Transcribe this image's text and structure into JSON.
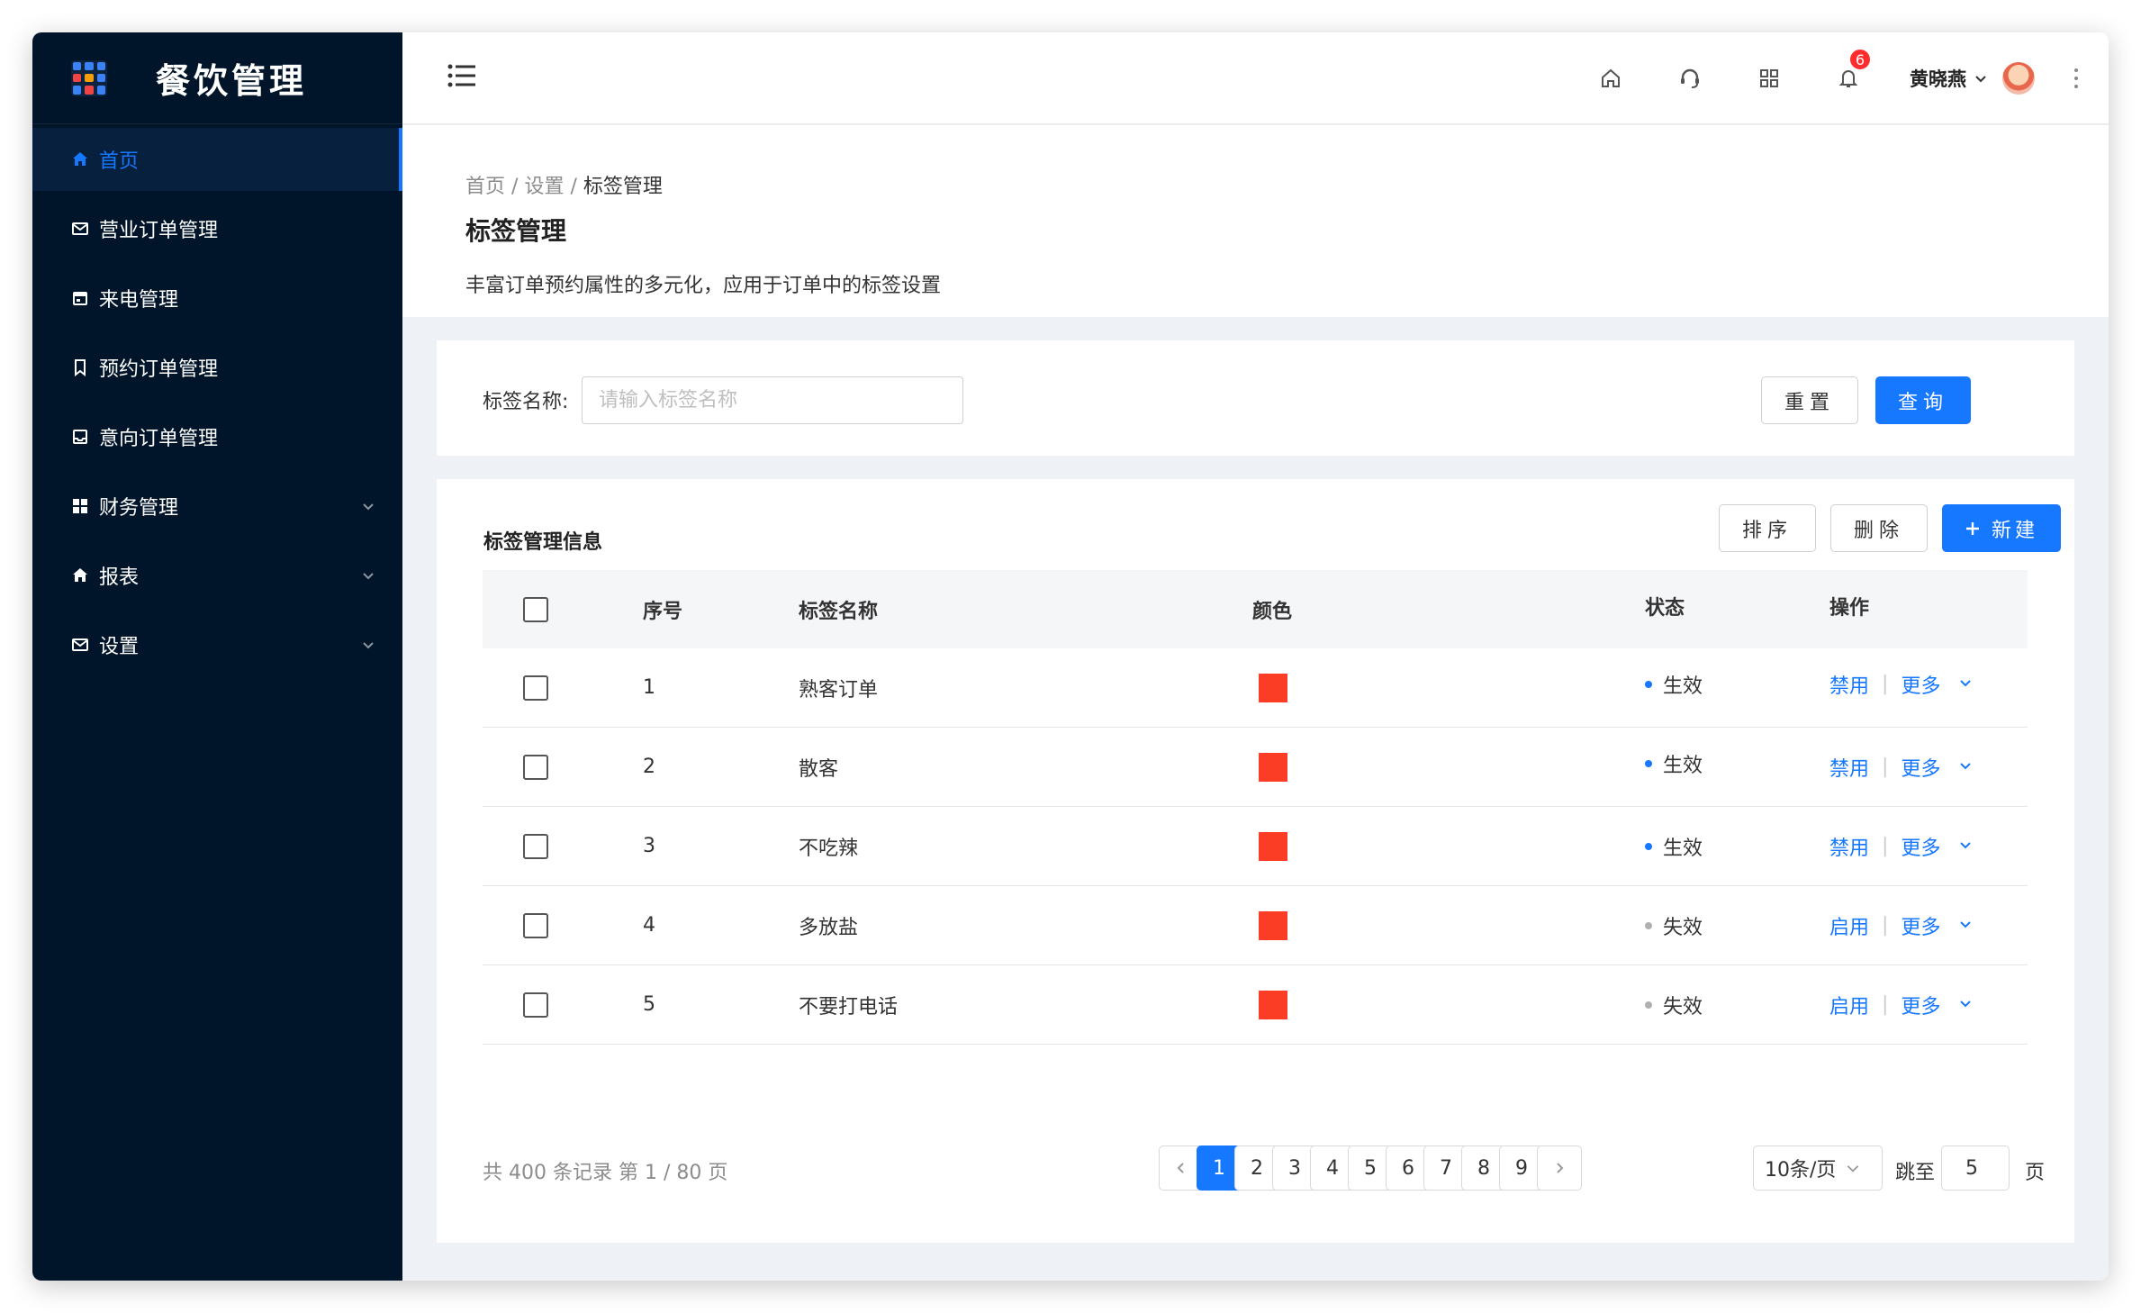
{
  "brand": {
    "title": "餐饮管理"
  },
  "sidebar": {
    "items": [
      {
        "label": "首页",
        "icon": "home-icon",
        "active": true
      },
      {
        "label": "营业订单管理",
        "icon": "mail-icon"
      },
      {
        "label": "来电管理",
        "icon": "calendar-icon"
      },
      {
        "label": "预约订单管理",
        "icon": "bookmark-icon"
      },
      {
        "label": "意向订单管理",
        "icon": "inbox-icon"
      },
      {
        "label": "财务管理",
        "icon": "dashboard-icon",
        "expandable": true
      },
      {
        "label": "报表",
        "icon": "home-icon",
        "expandable": true
      },
      {
        "label": "设置",
        "icon": "mail-icon",
        "expandable": true
      }
    ]
  },
  "header": {
    "notification_count": "6",
    "user_name": "黄晓燕"
  },
  "breadcrumb": {
    "home": "首页",
    "sep1": "/",
    "settings": "设置",
    "sep2": "/",
    "current": "标签管理"
  },
  "page": {
    "title": "标签管理",
    "description": "丰富订单预约属性的多元化，应用于订单中的标签设置"
  },
  "search": {
    "label": "标签名称:",
    "placeholder": "请输入标签名称",
    "value": "",
    "reset_label": "重置",
    "query_label": "查询"
  },
  "table_card": {
    "title": "标签管理信息",
    "sort_label": "排序",
    "delete_label": "删除",
    "new_label": "新建"
  },
  "table": {
    "columns": {
      "index": "序号",
      "name": "标签名称",
      "color": "颜色",
      "status": "状态",
      "actions": "操作"
    },
    "rows": [
      {
        "index": "1",
        "name": "熟客订单",
        "status": "生效",
        "action": "禁用",
        "more": "更多"
      },
      {
        "index": "2",
        "name": "散客",
        "status": "生效",
        "action": "禁用",
        "more": "更多"
      },
      {
        "index": "3",
        "name": "不吃辣",
        "status": "生效",
        "action": "禁用",
        "more": "更多"
      },
      {
        "index": "4",
        "name": "多放盐",
        "status": "失效",
        "action": "启用",
        "more": "更多"
      },
      {
        "index": "5",
        "name": "不要打电话",
        "status": "失效",
        "action": "启用",
        "more": "更多"
      }
    ],
    "swatch_color": "#fa3d24",
    "active_dot_color": "#1677ff",
    "inactive_dot_color": "#b0b0b0"
  },
  "pagination": {
    "total_text": "共 400 条记录 第 1 / 80 页",
    "pages": [
      "1",
      "2",
      "3",
      "4",
      "5",
      "6",
      "7",
      "8",
      "9"
    ],
    "current_page": "1",
    "page_size": "10条/页",
    "jump_label": "跳至",
    "jump_value": "5",
    "page_word": "页"
  },
  "colors": {
    "accent": "#1677ff",
    "sidebar_bg": "#001529"
  }
}
